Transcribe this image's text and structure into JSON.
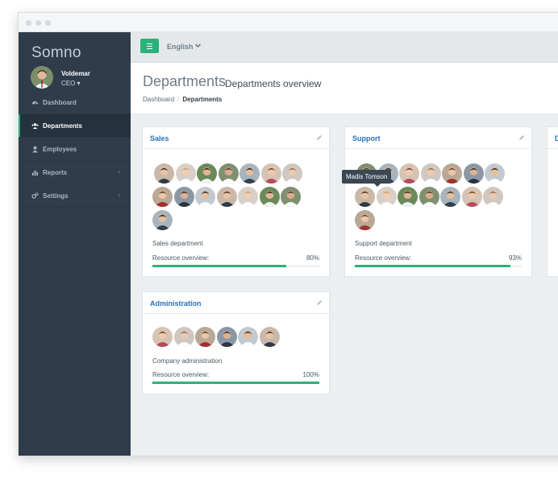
{
  "app": {
    "brand": "Somno"
  },
  "user": {
    "name": "Voldemar",
    "role": "CEO ▾"
  },
  "nav": {
    "items": [
      {
        "label": "Dashboard",
        "icon": "dashboard-icon"
      },
      {
        "label": "Departments",
        "icon": "users-icon",
        "active": true
      },
      {
        "label": "Employees",
        "icon": "user-icon"
      },
      {
        "label": "Reports",
        "icon": "bar-chart-icon",
        "arrow": "‹"
      },
      {
        "label": "Settings",
        "icon": "gears-icon",
        "arrow": "‹"
      }
    ]
  },
  "topbar": {
    "language": "English"
  },
  "page": {
    "title": "Departments",
    "subtitle": "Departments overview"
  },
  "breadcrumb": {
    "home": "Dashboard",
    "separator": "/",
    "current": "Departments"
  },
  "panels": {
    "sales": {
      "title": "Sales",
      "department": "Sales department",
      "resource_label": "Resource overview:",
      "percent_label": "80%",
      "percent": 80
    },
    "support": {
      "title": "Support",
      "department": "Support department",
      "resource_label": "Resource overview:",
      "percent_label": "93%",
      "percent": 93
    },
    "administration": {
      "title": "Administration",
      "department": "Company administration",
      "resource_label": "Resource overview:",
      "percent_label": "100%",
      "percent": 100
    },
    "partial": {
      "title": "D"
    }
  },
  "tooltip": {
    "text": "Madis Tomson"
  },
  "colors": {
    "accent": "#2ab27b",
    "link": "#2771b8",
    "sidebar": "#2f3d4b"
  }
}
